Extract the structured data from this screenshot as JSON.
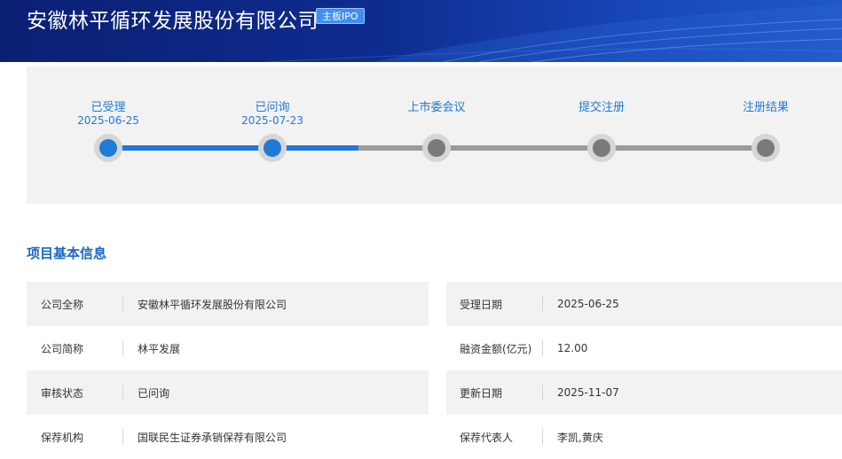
{
  "header": {
    "company_title": "安徽林平循环发展股份有限公司",
    "board_badge": "主板IPO"
  },
  "progress": {
    "steps": [
      {
        "name": "已受理",
        "date": "2025-06-25",
        "status": "done"
      },
      {
        "name": "已问询",
        "date": "2025-07-23",
        "status": "done"
      },
      {
        "name": "上市委会议",
        "date": "",
        "status": "pending"
      },
      {
        "name": "提交注册",
        "date": "",
        "status": "pending"
      },
      {
        "name": "注册结果",
        "date": "",
        "status": "pending"
      }
    ],
    "completed_fraction": 0.38
  },
  "section": {
    "title": "项目基本信息"
  },
  "info": {
    "rows": [
      [
        {
          "label": "公司全称",
          "value": "安徽林平循环发展股份有限公司"
        },
        {
          "label": "受理日期",
          "value": "2025-06-25"
        }
      ],
      [
        {
          "label": "公司简称",
          "value": "林平发展"
        },
        {
          "label": "融资金额(亿元)",
          "value": "12.00"
        }
      ],
      [
        {
          "label": "审核状态",
          "value": "已问询"
        },
        {
          "label": "更新日期",
          "value": "2025-11-07"
        }
      ],
      [
        {
          "label": "保荐机构",
          "value": "国联民生证券承销保荐有限公司"
        },
        {
          "label": "保荐代表人",
          "value": "李凯,黄庆"
        }
      ]
    ]
  },
  "colors": {
    "banner_dark": "#0b1f73",
    "accent_blue": "#1f7bd6",
    "section_title": "#1b68c4",
    "pending_gray": "#7a7a7a",
    "panel_bg": "#f2f2f2"
  }
}
